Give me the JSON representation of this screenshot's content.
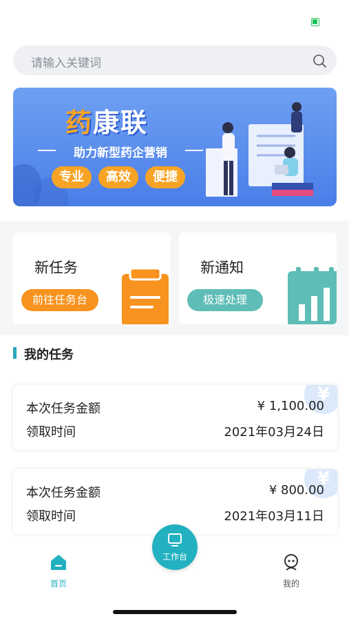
{
  "search": {
    "placeholder": "请输入关键词"
  },
  "banner": {
    "title_part1": "药",
    "title_part2": "康联",
    "subtitle": "助力新型药企营销",
    "tags": [
      "专业",
      "高效",
      "便捷"
    ]
  },
  "quick_cards": [
    {
      "title": "新任务",
      "button": "前往任务台",
      "accent": "#f7931e",
      "icon": "clipboard-icon"
    },
    {
      "title": "新通知",
      "button": "极速处理",
      "accent": "#5fbdb7",
      "icon": "bar-chart-icon"
    }
  ],
  "section": {
    "title": "我的任务"
  },
  "tasks": [
    {
      "amount_label": "本次任务金额",
      "amount": "¥ 1,100.00",
      "time_label": "领取时间",
      "time": "2021年03月24日"
    },
    {
      "amount_label": "本次任务金额",
      "amount": "¥ 800.00",
      "time_label": "领取时间",
      "time": "2021年03月11日"
    }
  ],
  "tabbar": {
    "home_label": "首页",
    "workbench_label": "工作台",
    "mine_label": "我的",
    "active_color": "#22b1c0",
    "inactive_color": "#555555"
  }
}
